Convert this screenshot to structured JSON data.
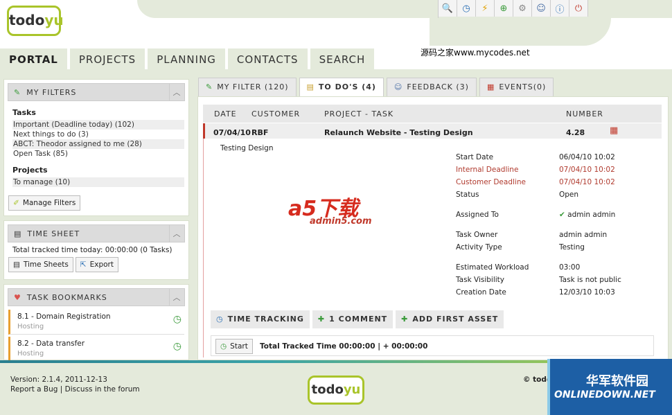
{
  "header": {
    "logo_text": "todo",
    "logo_accent": "yu",
    "watermark": "源码之家www.mycodes.net",
    "toolbar_icons": [
      "search-icon",
      "clock-icon",
      "lightning-icon",
      "add-icon",
      "gear-icon",
      "user-icon",
      "info-icon",
      "power-icon"
    ]
  },
  "nav": {
    "tabs": [
      "PORTAL",
      "PROJECTS",
      "PLANNING",
      "CONTACTS",
      "SEARCH"
    ],
    "active": "PORTAL"
  },
  "filters": {
    "title": "MY FILTERS",
    "tasks_title": "Tasks",
    "tasks": [
      "Important (Deadline today) (102)",
      "Next things to do (3)",
      "ABCT: Theodor assigned to me (28)",
      "Open Task (85)"
    ],
    "projects_title": "Projects",
    "projects": [
      "To manage (10)"
    ],
    "manage_btn": "Manage Filters"
  },
  "timesheet": {
    "title": "TIME SHEET",
    "tracked": "Total tracked time today: 00:00:00 (0 Tasks)",
    "btn_sheets": "Time Sheets",
    "btn_export": "Export"
  },
  "bookmarks": {
    "title": "TASK BOOKMARKS",
    "items": [
      {
        "title": "8.1 - Domain Registration",
        "sub": "Hosting"
      },
      {
        "title": "8.2 - Data transfer",
        "sub": "Hosting"
      }
    ]
  },
  "right_tabs": [
    "MY FILTER (120)",
    "TO DO'S (4)",
    "FEEDBACK (3)",
    "EVENTS(0)"
  ],
  "table": {
    "headers": {
      "date": "DATE",
      "customer": "CUSTOMER",
      "project_task": "PROJECT - TASK",
      "number": "NUMBER"
    },
    "row": {
      "date": "07/04/10",
      "customer": "RBF",
      "project_task": "Relaunch Website - Testing Design",
      "number": "4.28"
    }
  },
  "detail": {
    "title": "Testing Design",
    "fields": {
      "start_label": "Start Date",
      "start_value": "06/04/10 10:02",
      "internal_label": "Internal Deadline",
      "internal_value": "07/04/10 10:02",
      "customer_label": "Customer Deadline",
      "customer_value": "07/04/10 10:02",
      "status_label": "Status",
      "status_value": "Open",
      "assigned_label": "Assigned To",
      "assigned_value": "admin admin",
      "owner_label": "Task Owner",
      "owner_value": "admin admin",
      "activity_label": "Activity Type",
      "activity_value": "Testing",
      "workload_label": "Estimated Workload",
      "workload_value": "03:00",
      "visibility_label": "Task Visibility",
      "visibility_value": "Task is not public",
      "created_label": "Creation Date",
      "created_value": "12/03/10 10:03"
    },
    "watermark_a5": "a5下载",
    "watermark_a5_sub": "admin5.com"
  },
  "sub_tabs": [
    "TIME TRACKING",
    "1 COMMENT",
    "ADD FIRST ASSET"
  ],
  "tracking": {
    "start_btn": "Start",
    "total": "Total Tracked Time 00:00:00 | + 00:00:00"
  },
  "footer": {
    "version": "Version: 2.1.4, 2011-12-13",
    "report": "Report a Bug",
    "discuss": "Discuss in the forum",
    "copyright": "© todo",
    "ad_cn": "华军软件园",
    "ad_en": "ONLINEDOWN.NET"
  },
  "colors": {
    "accent": "#a9c42a",
    "red": "#b03a2e",
    "panel_bg": "#e4eadb"
  }
}
